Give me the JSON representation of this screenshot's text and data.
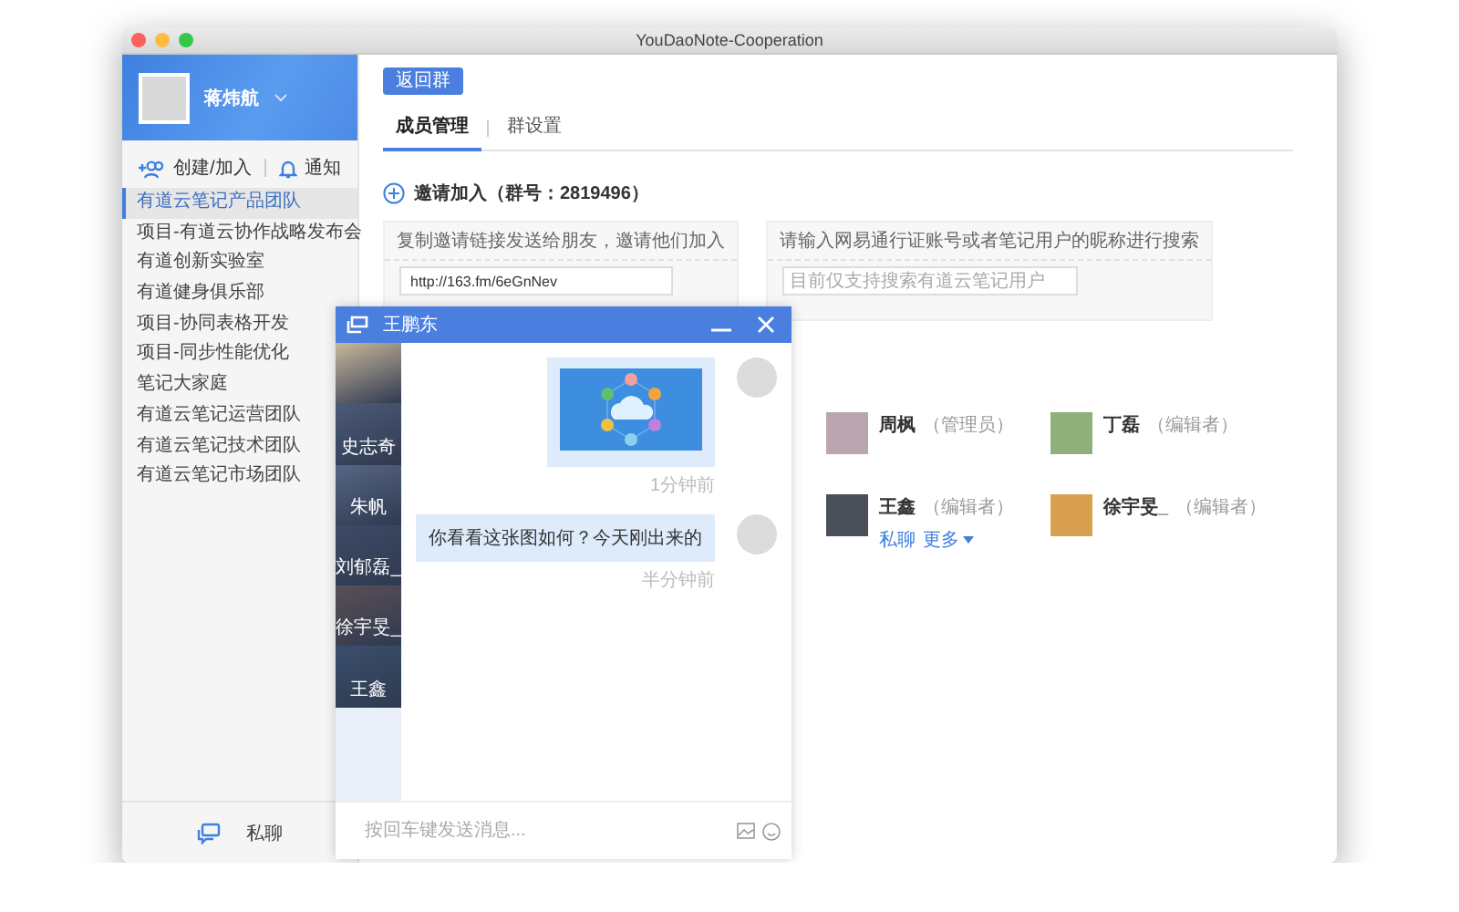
{
  "window": {
    "title": "YouDaoNote-Cooperation"
  },
  "sidebar": {
    "user": {
      "name": "蒋炜航"
    },
    "actions": [
      {
        "kind": "create",
        "label": "创建/加入"
      },
      {
        "kind": "notify",
        "label": "通知"
      }
    ],
    "groups": [
      {
        "label": "有道云笔记产品团队",
        "selected": true
      },
      {
        "label": "项目-有道云协作战略发布会",
        "selected": false
      },
      {
        "label": "有道创新实验室",
        "selected": false
      },
      {
        "label": "有道健身俱乐部",
        "selected": false
      },
      {
        "label": "项目-协同表格开发",
        "selected": false
      },
      {
        "label": "项目-同步性能优化",
        "selected": false
      },
      {
        "label": "笔记大家庭",
        "selected": false
      },
      {
        "label": "有道云笔记运营团队",
        "selected": false
      },
      {
        "label": "有道云笔记技术团队",
        "selected": false
      },
      {
        "label": "有道云笔记市场团队",
        "selected": false
      }
    ],
    "footer": {
      "label": "私聊"
    }
  },
  "main": {
    "back_button": "返回群",
    "tabs": [
      {
        "label": "成员管理",
        "selected": true
      },
      {
        "label": "群设置",
        "selected": false
      }
    ],
    "invite": {
      "heading": "邀请加入（群号：2819496）",
      "link_card": {
        "text": "复制邀请链接发送给朋友，邀请他们加入",
        "value": "http://163.fm/6eGnNev"
      },
      "search_card": {
        "text": "请输入网易通行证账号或者笔记用户的昵称进行搜索",
        "placeholder": "目前仅支持搜索有道云笔记用户"
      }
    },
    "members": [
      {
        "name": "周枫",
        "role": "（管理员）"
      },
      {
        "name": "丁磊",
        "role": "（编辑者）"
      },
      {
        "name": "王鑫",
        "role": "（编辑者）",
        "actions": [
          "私聊",
          "更多"
        ]
      },
      {
        "name": "徐宇旻_",
        "role": "（编辑者）"
      }
    ]
  },
  "chat": {
    "title": "王鹏东",
    "contacts": [
      {
        "kind": "photo"
      },
      {
        "kind": "named",
        "name": "史志奇"
      },
      {
        "kind": "named",
        "name": "朱帆"
      },
      {
        "kind": "named",
        "name": "刘郁磊_"
      },
      {
        "kind": "named",
        "name": "徐宇旻_"
      },
      {
        "kind": "named",
        "name": "王鑫"
      }
    ],
    "messages": [
      {
        "kind": "image",
        "time": "1分钟前"
      },
      {
        "kind": "text",
        "text": "你看看这张图如何？今天刚出来的",
        "time": "半分钟前"
      }
    ],
    "input": {
      "placeholder": "按回车键发送消息..."
    }
  }
}
